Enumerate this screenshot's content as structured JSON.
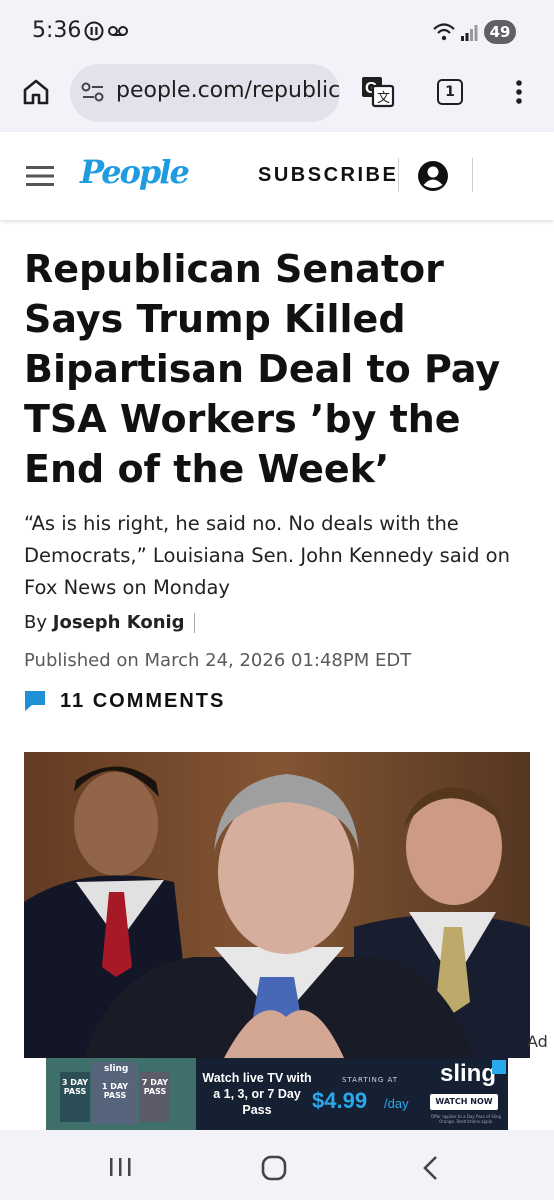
{
  "status": {
    "time": "5:36",
    "battery": "49"
  },
  "browser": {
    "url": "people.com/republic",
    "tab_count": "1"
  },
  "header": {
    "logo": "People",
    "subscribe": "SUBSCRIBE"
  },
  "article": {
    "headline": "Republican Senator Says Trump Killed Bipartisan Deal to Pay TSA Workers ’by the End of the Week’",
    "dek": "“As is his right, he said no. No deals with the Democrats,” Louisiana Sen. John Kennedy said on Fox News on Monday",
    "by_prefix": "By",
    "author": "Joseph Konig",
    "published": "Published on March 24, 2026 01:48PM EDT",
    "comments": "11 COMMENTS"
  },
  "ad": {
    "label": "Ad",
    "pass_3": "3 DAY PASS",
    "pass_1": "1 DAY PASS",
    "pass_7": "7 DAY PASS",
    "sling_small": "sling",
    "headline": "Watch live TV with a 1, 3, or 7 Day Pass",
    "starting_at": "STARTING AT",
    "price": "$4.99",
    "per": "/day",
    "brand": "sling",
    "cta": "WATCH NOW",
    "fine_print": "Offer applies to a Day Pass of Sling Orange. Restrictions apply."
  },
  "colors": {
    "brand_blue": "#1f9be0",
    "ad_bg": "#152033",
    "price_blue": "#2aa8ec"
  },
  "icons": [
    "menu-icon",
    "user-icon",
    "home-icon",
    "site-settings-icon",
    "translate-icon",
    "more-icon",
    "comment-icon",
    "recents-icon",
    "home-nav-icon",
    "back-icon"
  ]
}
